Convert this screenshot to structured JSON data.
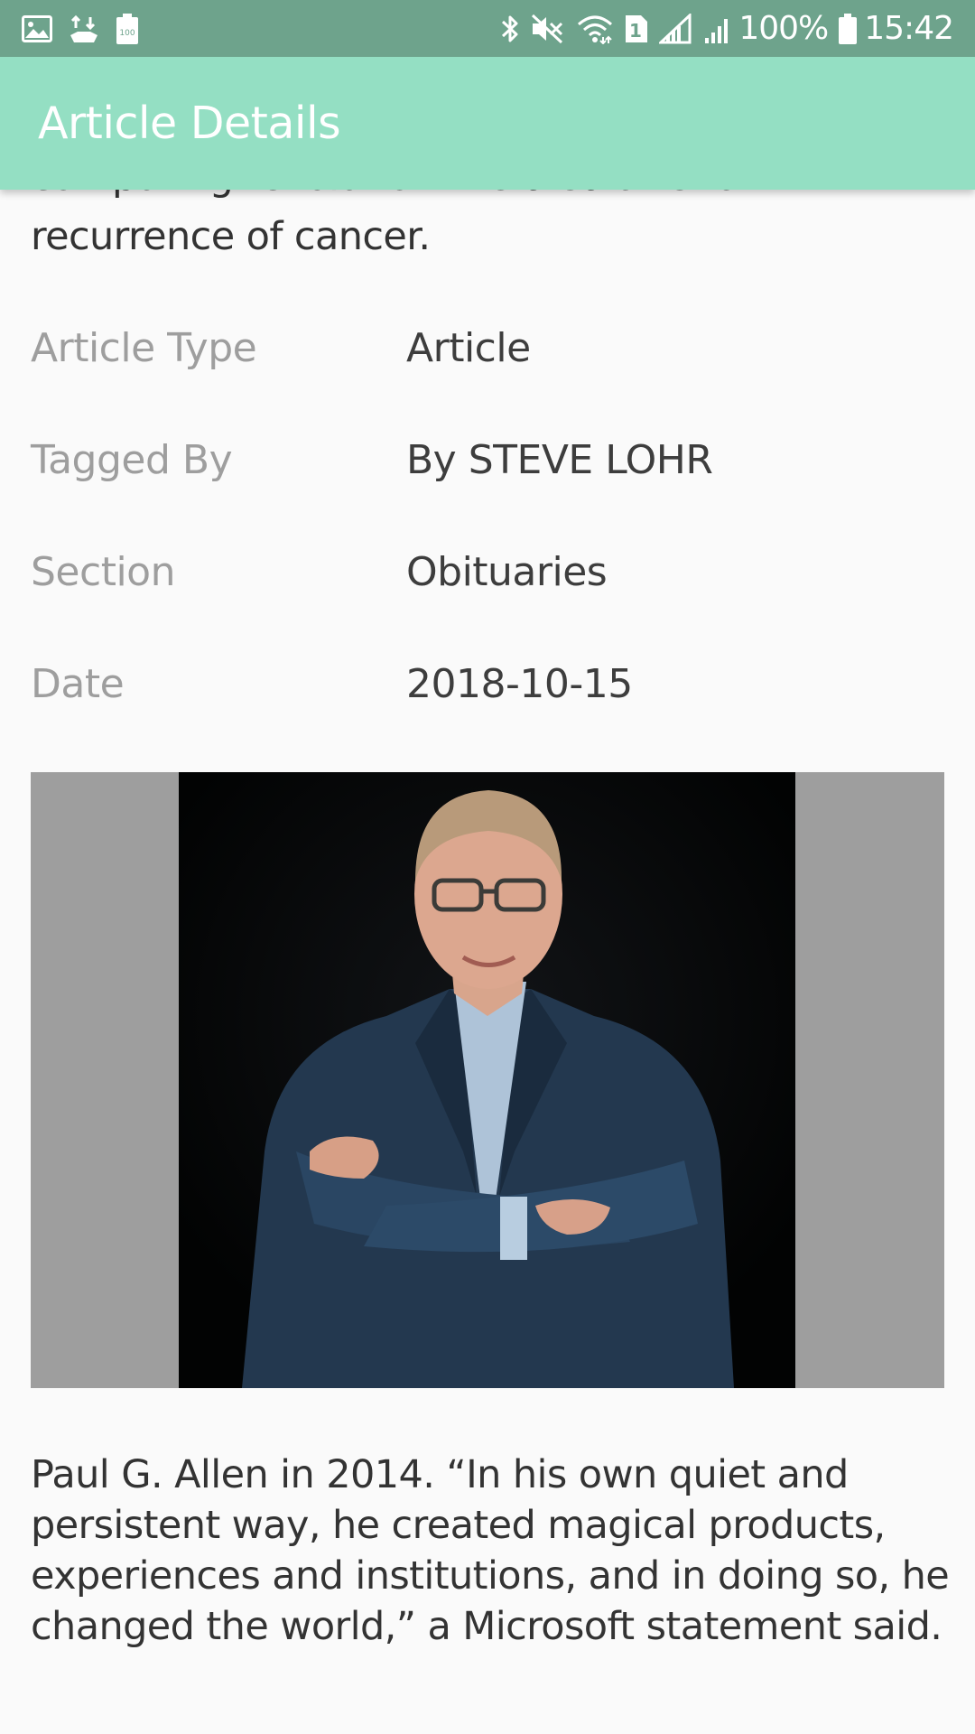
{
  "status_bar": {
    "left_icons": [
      "gallery-icon",
      "usb-transfer-icon",
      "battery-saver-icon"
    ],
    "right_icons": [
      "bluetooth-icon",
      "mute-icon",
      "wifi-icon",
      "sim-1-icon",
      "signal-icon",
      "signal-2-icon",
      "battery-icon"
    ],
    "sim_slot": "1",
    "battery_saver_label": "100",
    "battery": "100%",
    "time": "15:42"
  },
  "app_bar": {
    "title": "Article Details",
    "background_color": "#94dfc3",
    "status_color": "#6ea38c"
  },
  "article": {
    "summary_partial_line": "computing revolution. He died after a",
    "summary_tail": "recurrence of cancer.",
    "details": [
      {
        "label": "Article Type",
        "value": "Article"
      },
      {
        "label": "Tagged By",
        "value": "By STEVE LOHR"
      },
      {
        "label": "Section",
        "value": "Obituaries"
      },
      {
        "label": "Date",
        "value": "2018-10-15"
      }
    ],
    "image_caption": "Paul G. Allen in 2014. “In his own quiet and persistent way, he created magical products, experiences and institutions, and in doing so, he changed the world,” a Microsoft statement said."
  }
}
